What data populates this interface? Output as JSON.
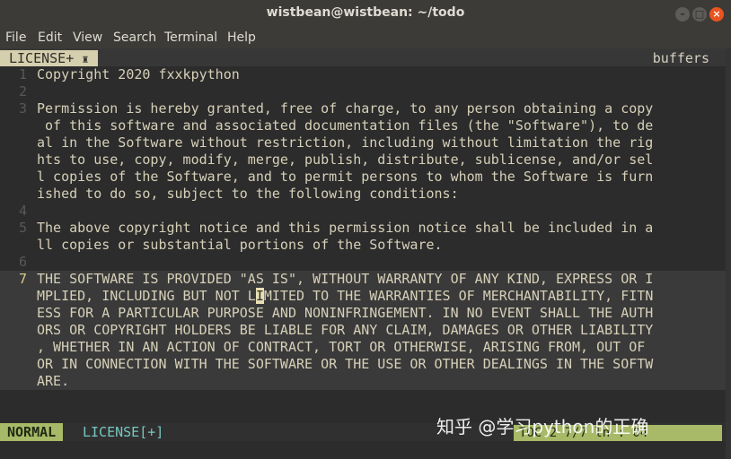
{
  "window": {
    "title": "wistbean@wistbean: ~/todo"
  },
  "menubar": {
    "items": [
      "File",
      "Edit",
      "View",
      "Search",
      "Terminal",
      "Help"
    ]
  },
  "tabline": {
    "active_tab": "LICENSE+",
    "buffers_label": "buffers"
  },
  "editor": {
    "lines": [
      {
        "num": "1",
        "text": "Copyright 2020 fxxkpython"
      },
      {
        "num": "2",
        "text": ""
      },
      {
        "num": "3",
        "text": "Permission is hereby granted, free of charge, to any person obtaining a copy"
      },
      {
        "num": "",
        "text": " of this software and associated documentation files (the \"Software\"), to de"
      },
      {
        "num": "",
        "text": "al in the Software without restriction, including without limitation the rig"
      },
      {
        "num": "",
        "text": "hts to use, copy, modify, merge, publish, distribute, sublicense, and/or sel"
      },
      {
        "num": "",
        "text": "l copies of the Software, and to permit persons to whom the Software is furn"
      },
      {
        "num": "",
        "text": "ished to do so, subject to the following conditions:"
      },
      {
        "num": "4",
        "text": ""
      },
      {
        "num": "5",
        "text": "The above copyright notice and this permission notice shall be included in a"
      },
      {
        "num": "",
        "text": "ll copies or substantial portions of the Software."
      },
      {
        "num": "6",
        "text": ""
      },
      {
        "num": "7",
        "text": "THE SOFTWARE IS PROVIDED \"AS IS\", WITHOUT WARRANTY OF ANY KIND, EXPRESS OR I"
      },
      {
        "num": "",
        "text_before": "MPLIED, INCLUDING BUT NOT L",
        "cursor_char": "I",
        "text_after": "MITED TO THE WARRANTIES OF MERCHANTABILITY, FITN"
      },
      {
        "num": "",
        "text": "ESS FOR A PARTICULAR PURPOSE AND NONINFRINGEMENT. IN NO EVENT SHALL THE AUTH"
      },
      {
        "num": "",
        "text": "ORS OR COPYRIGHT HOLDERS BE LIABLE FOR ANY CLAIM, DAMAGES OR OTHER LIABILITY"
      },
      {
        "num": "",
        "text": ", WHETHER IN AN ACTION OF CONTRACT, TORT OR OTHERWISE, ARISING FROM, OUT OF"
      },
      {
        "num": "",
        "text": "OR IN CONNECTION WITH THE SOFTWARE OR THE USE OR OTHER DEALINGS IN THE SOFTW"
      },
      {
        "num": "",
        "text": "ARE."
      }
    ]
  },
  "statusline": {
    "mode": "NORMAL",
    "filename": "LICENSE[+]",
    "position": "TOC 2   7/7 ln : 04"
  },
  "watermark": "知乎 @学习python的正确"
}
